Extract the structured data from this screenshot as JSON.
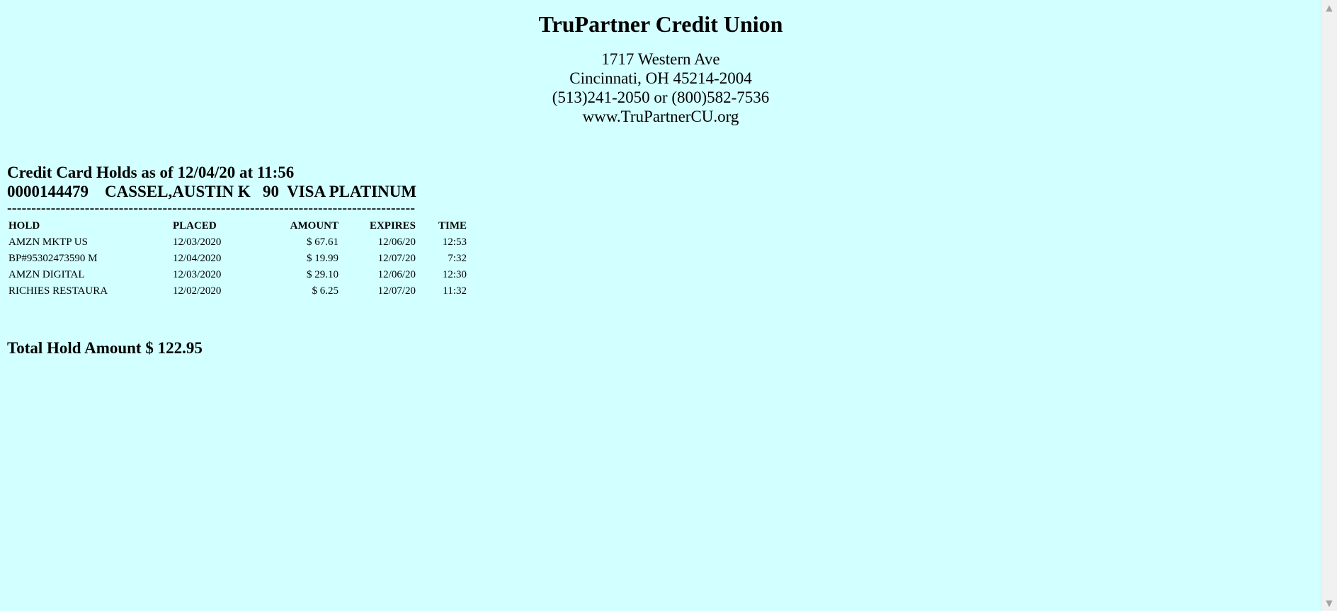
{
  "header": {
    "cu_name": "TruPartner Credit Union",
    "address_line1": "1717 Western Ave",
    "address_line2": "Cincinnati, OH 45214-2004",
    "phone": "(513)241-2050 or (800)582-7536",
    "website": "www.TruPartnerCU.org"
  },
  "report": {
    "title": "Credit Card Holds as of 12/04/20 at 11:56",
    "account_line": "0000144479    CASSEL,AUSTIN K   90  VISA PLATINUM",
    "divider": "------------------------------------------------------------------------------------"
  },
  "table": {
    "headers": {
      "hold": "HOLD",
      "placed": "PLACED",
      "amount": "AMOUNT",
      "expires": "EXPIRES",
      "time": "TIME"
    },
    "rows": [
      {
        "hold": "AMZN MKTP US",
        "placed": "12/03/2020",
        "amount": "$ 67.61",
        "expires": "12/06/20",
        "time": "12:53"
      },
      {
        "hold": "BP#95302473590 M",
        "placed": "12/04/2020",
        "amount": "$ 19.99",
        "expires": "12/07/20",
        "time": "7:32"
      },
      {
        "hold": "AMZN DIGITAL",
        "placed": "12/03/2020",
        "amount": "$ 29.10",
        "expires": "12/06/20",
        "time": "12:30"
      },
      {
        "hold": "RICHIES RESTAURA",
        "placed": "12/02/2020",
        "amount": "$ 6.25",
        "expires": "12/07/20",
        "time": "11:32"
      }
    ]
  },
  "total": {
    "label": "Total Hold Amount $ 122.95"
  },
  "scrollbar": {
    "up_icon": "chevron-up-icon",
    "down_icon": "chevron-down-icon"
  },
  "colors": {
    "background": "#d2ffff"
  }
}
